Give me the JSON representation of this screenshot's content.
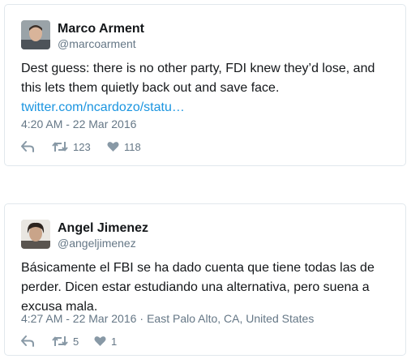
{
  "tweets": [
    {
      "author_name": "Marco Arment",
      "author_handle": "@marcoarment",
      "text_lines": [
        "Dest guess: there is no other party, FDI knew they’d lose, and",
        "this lets them quietly back out and save face."
      ],
      "link": "twitter.com/ncardozo/statu…",
      "timestamp": "4:20 AM - 22 Mar 2016",
      "location": "",
      "retweets": "123",
      "likes": "118"
    },
    {
      "author_name": "Angel Jimenez",
      "author_handle": "@angeljimenez",
      "text_lines": [
        "Básicamente el FBI se ha dado cuenta que tiene todas las de",
        "perder. Dicen estar estudiando una alternativa, pero suena a",
        "excusa mala."
      ],
      "link": "",
      "timestamp": "4:27 AM - 22 Mar 2016",
      "location": "East Palo Alto, CA, United States",
      "retweets": "5",
      "likes": "1"
    }
  ],
  "colors": {
    "link": "#1b95e0",
    "secondary_text": "#657786",
    "border": "#e1e8ed"
  },
  "icons": [
    "reply-icon",
    "retweet-icon",
    "heart-icon"
  ]
}
